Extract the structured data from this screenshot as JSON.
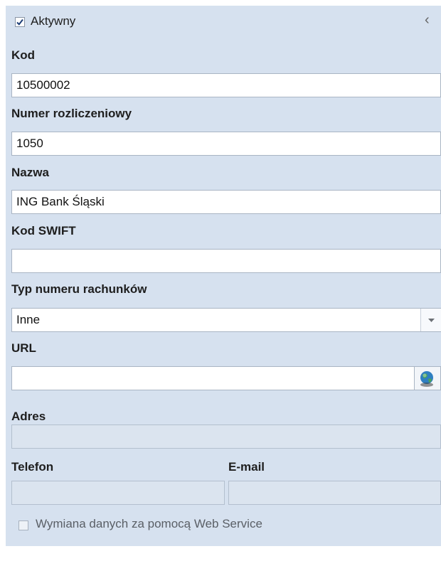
{
  "active": {
    "label": "Aktywny",
    "checked": true
  },
  "collapse_icon": "‹",
  "fields": {
    "kod": {
      "label": "Kod",
      "value": "10500002"
    },
    "numer": {
      "label": "Numer rozliczeniowy",
      "value": "1050"
    },
    "nazwa": {
      "label": "Nazwa",
      "value": "ING Bank Śląski"
    },
    "swift": {
      "label": "Kod SWIFT",
      "value": ""
    },
    "typ": {
      "label": "Typ numeru rachunków",
      "value": "Inne"
    },
    "url": {
      "label": "URL",
      "value": ""
    },
    "adres": {
      "label": "Adres",
      "value": ""
    },
    "telefon": {
      "label": "Telefon",
      "value": ""
    },
    "email": {
      "label": "E-mail",
      "value": ""
    }
  },
  "webservice": {
    "label": "Wymiana danych za pomocą Web Service",
    "checked": false
  },
  "icons": {
    "check": "check-mark-icon",
    "dropdown": "chevron-down-icon",
    "globe": "globe-icon",
    "collapse": "chevron-left-icon"
  },
  "colors": {
    "panel_bg": "#d6e1ef",
    "field_border": "#a9b5c4",
    "disabled_bg": "#dbe4ef"
  }
}
